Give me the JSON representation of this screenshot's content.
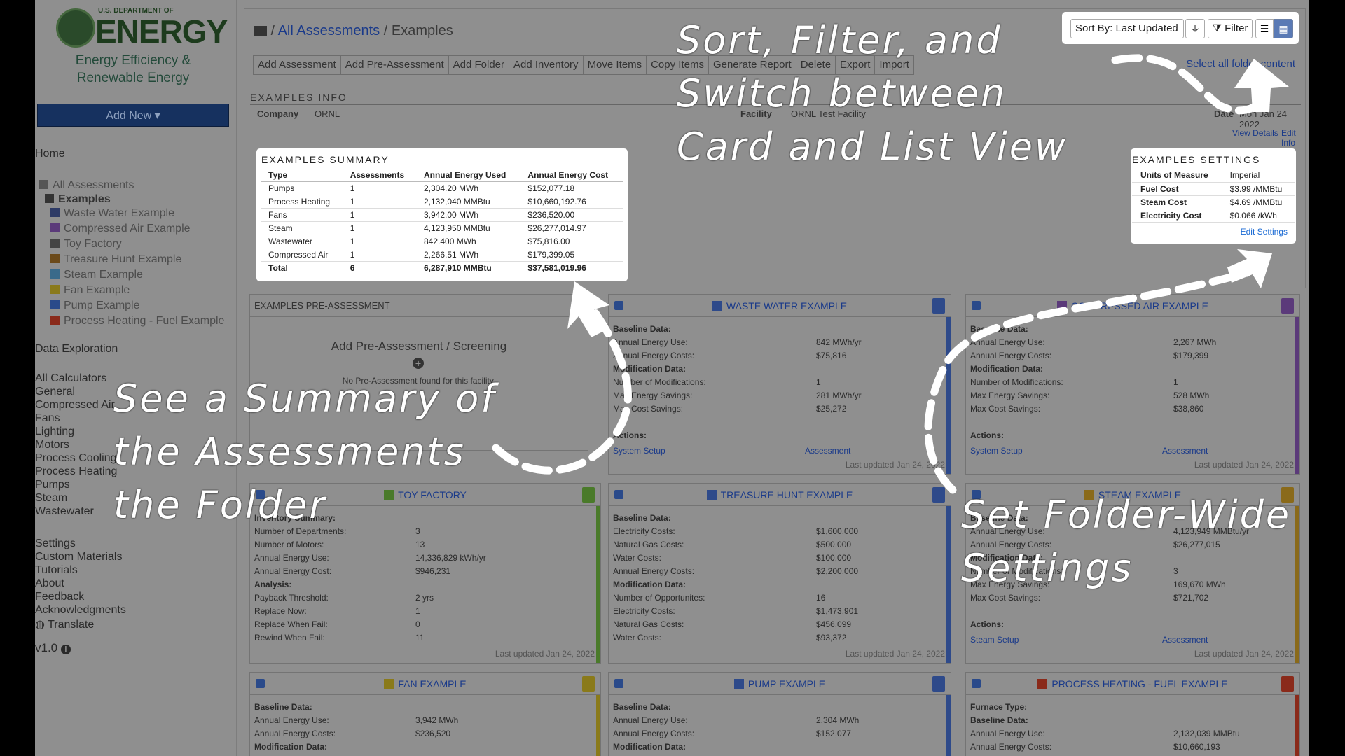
{
  "logo": {
    "dept": "U.S. DEPARTMENT OF",
    "energy": "ENERGY",
    "sub1": "Energy Efficiency &",
    "sub2": "Renewable Energy"
  },
  "sidebar": {
    "add_new": "Add New",
    "home": "Home",
    "all_assessments": "All Assessments",
    "folder": "Examples",
    "tree": [
      {
        "label": "Waste Water Example",
        "color": "#2e3b66"
      },
      {
        "label": "Compressed Air Example",
        "color": "#5b3a7a"
      },
      {
        "label": "Toy Factory",
        "color": "#444444"
      },
      {
        "label": "Treasure Hunt Example",
        "color": "#6b4a1a"
      },
      {
        "label": "Steam Example",
        "color": "#3a6a8a"
      },
      {
        "label": "Fan Example",
        "color": "#8a7a1a"
      },
      {
        "label": "Pump Example",
        "color": "#2a4a8a"
      },
      {
        "label": "Process Heating - Fuel Example",
        "color": "#8a2a1a"
      }
    ],
    "data_exploration": "Data Exploration",
    "calculators": [
      "All Calculators",
      "General",
      "Compressed Air",
      "Fans",
      "Lighting",
      "Motors",
      "Process Cooling",
      "Process Heating",
      "Pumps",
      "Steam",
      "Wastewater"
    ],
    "bottom": [
      "Settings",
      "Custom Materials",
      "Tutorials",
      "About",
      "Feedback",
      "Acknowledgments",
      "Translate"
    ],
    "version": "v1.0"
  },
  "breadcrumb": {
    "root": "All Assessments",
    "sep": "/",
    "current": "Examples"
  },
  "toolbar": [
    "Add Assessment",
    "Add Pre-Assessment",
    "Add Folder",
    "Add Inventory",
    "Move Items",
    "Copy Items",
    "Generate Report",
    "Delete",
    "Export",
    "Import"
  ],
  "select_all": "Select all folder content",
  "sort": {
    "label": "Sort By: Last Updated",
    "filter": "Filter"
  },
  "info": {
    "heading": "EXAMPLES INFO",
    "company_label": "Company",
    "company": "ORNL",
    "facility_label": "Facility",
    "facility": "ORNL Test Facility",
    "date_label": "Date",
    "date": "Mon Jan 24 2022",
    "view_details": "View Details",
    "edit_info": "Edit Info"
  },
  "summary": {
    "heading": "EXAMPLES SUMMARY",
    "columns": [
      "Type",
      "Assessments",
      "Annual Energy Used",
      "Annual Energy Cost"
    ],
    "rows": [
      [
        "Pumps",
        "1",
        "2,304.20 MWh",
        "$152,077.18"
      ],
      [
        "Process Heating",
        "1",
        "2,132,040 MMBtu",
        "$10,660,192.76"
      ],
      [
        "Fans",
        "1",
        "3,942.00 MWh",
        "$236,520.00"
      ],
      [
        "Steam",
        "1",
        "4,123,950 MMBtu",
        "$26,277,014.97"
      ],
      [
        "Wastewater",
        "1",
        "842.400 MWh",
        "$75,816.00"
      ],
      [
        "Compressed Air",
        "1",
        "2,266.51 MWh",
        "$179,399.05"
      ]
    ],
    "total": [
      "Total",
      "6",
      "6,287,910 MMBtu",
      "$37,581,019.96"
    ]
  },
  "settings": {
    "heading": "EXAMPLES SETTINGS",
    "rows": [
      [
        "Units of Measure",
        "Imperial"
      ],
      [
        "Fuel Cost",
        "$3.99 /MMBtu"
      ],
      [
        "Steam Cost",
        "$4.69 /MMBtu"
      ],
      [
        "Electricity Cost",
        "$0.066 /kWh"
      ]
    ],
    "edit": "Edit Settings"
  },
  "preassessment": {
    "heading": "EXAMPLES PRE-ASSESSMENT",
    "add": "Add Pre-Assessment / Screening",
    "none": "No Pre-Assessment found for this facility."
  },
  "cards": {
    "wastewater": {
      "title": "WASTE WATER EXAMPLE",
      "color": "#2e4a8a",
      "lines": [
        [
          "Baseline Data:",
          ""
        ],
        [
          "Annual Energy Use:",
          "842 MWh/yr"
        ],
        [
          "Annual Energy Costs:",
          "$75,816"
        ],
        [
          "Modification Data:",
          ""
        ],
        [
          "Number of Modifications:",
          "1"
        ],
        [
          "Max Energy Savings:",
          "281 MWh/yr"
        ],
        [
          "Max Cost Savings:",
          "$25,272"
        ],
        [
          "",
          ""
        ],
        [
          "Actions:",
          ""
        ]
      ],
      "act1": "System Setup",
      "act2": "Assessment",
      "updated": "Last updated Jan 24, 2022"
    },
    "compressed": {
      "title": "COMPRESSED AIR EXAMPLE",
      "color": "#5b3a7a",
      "lines": [
        [
          "Baseline Data:",
          ""
        ],
        [
          "Annual Energy Use:",
          "2,267 MWh"
        ],
        [
          "Annual Energy Costs:",
          "$179,399"
        ],
        [
          "Modification Data:",
          ""
        ],
        [
          "Number of Modifications:",
          "1"
        ],
        [
          "Max Energy Savings:",
          "528 MWh"
        ],
        [
          "Max Cost Savings:",
          "$38,860"
        ],
        [
          "",
          ""
        ],
        [
          "Actions:",
          ""
        ]
      ],
      "act1": "System Setup",
      "act2": "Assessment",
      "updated": "Last updated Jan 24, 2022"
    },
    "toy": {
      "title": "TOY FACTORY",
      "color": "#4a7a2a",
      "lines": [
        [
          "Inventory Summary:",
          ""
        ],
        [
          "Number of Departments:",
          "3"
        ],
        [
          "Number of Motors:",
          "13"
        ],
        [
          "Annual Energy Use:",
          "14,336,829 kWh/yr"
        ],
        [
          "Annual Energy Cost:",
          "$946,231"
        ],
        [
          "Analysis:",
          ""
        ],
        [
          "Payback Threshold:",
          "2 yrs"
        ],
        [
          "Replace Now:",
          "1"
        ],
        [
          "Replace When Fail:",
          "0"
        ],
        [
          "Rewind When Fail:",
          "11"
        ]
      ],
      "updated": "Last updated Jan 24, 2022"
    },
    "treasure": {
      "title": "TREASURE HUNT EXAMPLE",
      "color": "#2e4a8a",
      "lines": [
        [
          "Baseline Data:",
          ""
        ],
        [
          "Electricity Costs:",
          "$1,600,000"
        ],
        [
          "Natural Gas Costs:",
          "$500,000"
        ],
        [
          "Water Costs:",
          "$100,000"
        ],
        [
          "Annual Energy Costs:",
          "$2,200,000"
        ],
        [
          "Modification Data:",
          ""
        ],
        [
          "Number of Opportunites:",
          "16"
        ],
        [
          "Electricity Costs:",
          "$1,473,901"
        ],
        [
          "Natural Gas Costs:",
          "$456,099"
        ],
        [
          "Water Costs:",
          "$93,372"
        ]
      ],
      "updated": "Last updated Jan 24, 2022"
    },
    "steam": {
      "title": "STEAM EXAMPLE",
      "color": "#8a6a1a",
      "lines": [
        [
          "Baseline Data:",
          ""
        ],
        [
          "Annual Energy Use:",
          "4,123,949 MMBtu/yr"
        ],
        [
          "Annual Energy Costs:",
          "$26,277,015"
        ],
        [
          "Modification Data:",
          ""
        ],
        [
          "Number of Modifications:",
          "3"
        ],
        [
          "Max Energy Savings:",
          "169,670 MWh"
        ],
        [
          "Max Cost Savings:",
          "$721,702"
        ],
        [
          "",
          ""
        ],
        [
          "Actions:",
          ""
        ]
      ],
      "act1": "Steam Setup",
      "act2": "Assessment",
      "updated": "Last updated Jan 24, 2022"
    },
    "fan": {
      "title": "FAN EXAMPLE",
      "color": "#8a7a1a",
      "lines": [
        [
          "Baseline Data:",
          ""
        ],
        [
          "Annual Energy Use:",
          "3,942 MWh"
        ],
        [
          "Annual Energy Costs:",
          "$236,520"
        ],
        [
          "Modification Data:",
          ""
        ]
      ]
    },
    "pump": {
      "title": "PUMP EXAMPLE",
      "color": "#2e4a8a",
      "lines": [
        [
          "Baseline Data:",
          ""
        ],
        [
          "Annual Energy Use:",
          "2,304 MWh"
        ],
        [
          "Annual Energy Costs:",
          "$152,077"
        ],
        [
          "Modification Data:",
          ""
        ]
      ]
    },
    "heating": {
      "title": "PROCESS HEATING - FUEL EXAMPLE",
      "color": "#8a2a1a",
      "lines": [
        [
          "Furnace Type:",
          ""
        ],
        [
          "Baseline Data:",
          ""
        ],
        [
          "Annual Energy Use:",
          "2,132,039 MMBtu"
        ],
        [
          "Annual Energy Costs:",
          "$10,660,193"
        ]
      ]
    }
  },
  "annotations": {
    "sort": [
      "Sort, Filter, and",
      "Switch between",
      "Card and List View"
    ],
    "summary": [
      "See a Summary of",
      "the Assessments",
      "the Folder"
    ],
    "settings": [
      "Set Folder-Wide",
      "Settings"
    ]
  }
}
